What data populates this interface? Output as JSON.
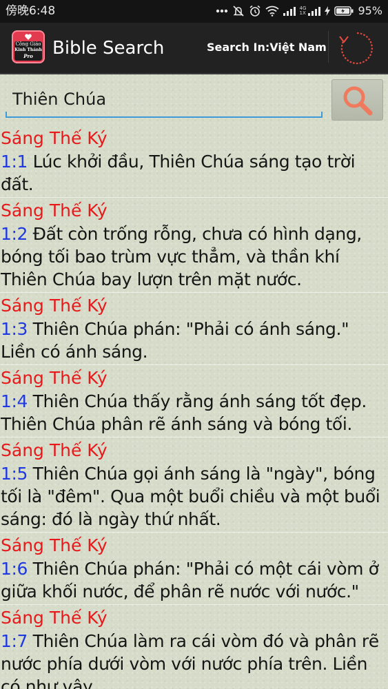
{
  "status_bar": {
    "time": "傍晚6:48",
    "network_label_top": "4G",
    "network_label_bottom": "1X",
    "battery": "95%",
    "icons": [
      "more-dots-icon",
      "mute-icon",
      "alarm-icon",
      "wifi-icon",
      "signal-icon",
      "signal-icon-2",
      "charging-icon",
      "battery-icon"
    ]
  },
  "app_bar": {
    "logo_line1": "Công Giáo",
    "logo_line2": "Kinh Thánh",
    "logo_line3": "Pro",
    "title": "Bible Search",
    "search_in": "Search In:Việt Nam",
    "refresh_icon": "refresh-icon"
  },
  "search": {
    "value": "Thiên Chúa",
    "button_icon": "search-icon"
  },
  "colors": {
    "book": "#e8191b",
    "reference": "#1f38e0",
    "accent": "#3e9ad6",
    "search_icon": "#f07a5e"
  },
  "results": [
    {
      "book": "Sáng Thế Ký",
      "ref": "1:1",
      "text": "Lúc khởi đầu, Thiên Chúa sáng tạo trời đất."
    },
    {
      "book": "Sáng Thế Ký",
      "ref": "1:2",
      "text": "Đất còn trống rỗng, chưa có hình dạng, bóng tối bao trùm vực thẳm, và thần khí Thiên Chúa bay lượn trên mặt nước."
    },
    {
      "book": "Sáng Thế Ký",
      "ref": "1:3",
      "text": "Thiên Chúa phán: \"Phải có ánh sáng.\" Liền có ánh sáng."
    },
    {
      "book": "Sáng Thế Ký",
      "ref": "1:4",
      "text": "Thiên Chúa thấy rằng ánh sáng tốt đẹp. Thiên Chúa phân rẽ ánh sáng và bóng tối."
    },
    {
      "book": "Sáng Thế Ký",
      "ref": "1:5",
      "text": "Thiên Chúa gọi ánh sáng là \"ngày\", bóng tối là \"đêm\". Qua một buổi chiều và một buổi sáng: đó là ngày thứ nhất."
    },
    {
      "book": "Sáng Thế Ký",
      "ref": "1:6",
      "text": "Thiên Chúa phán: \"Phải có một cái vòm ở giữa khối nước, để phân rẽ nước với nước.\""
    },
    {
      "book": "Sáng Thế Ký",
      "ref": "1:7",
      "text": "Thiên Chúa làm ra cái vòm đó và phân rẽ nước phía dưới vòm với nước phía trên. Liền có như vậy."
    }
  ]
}
